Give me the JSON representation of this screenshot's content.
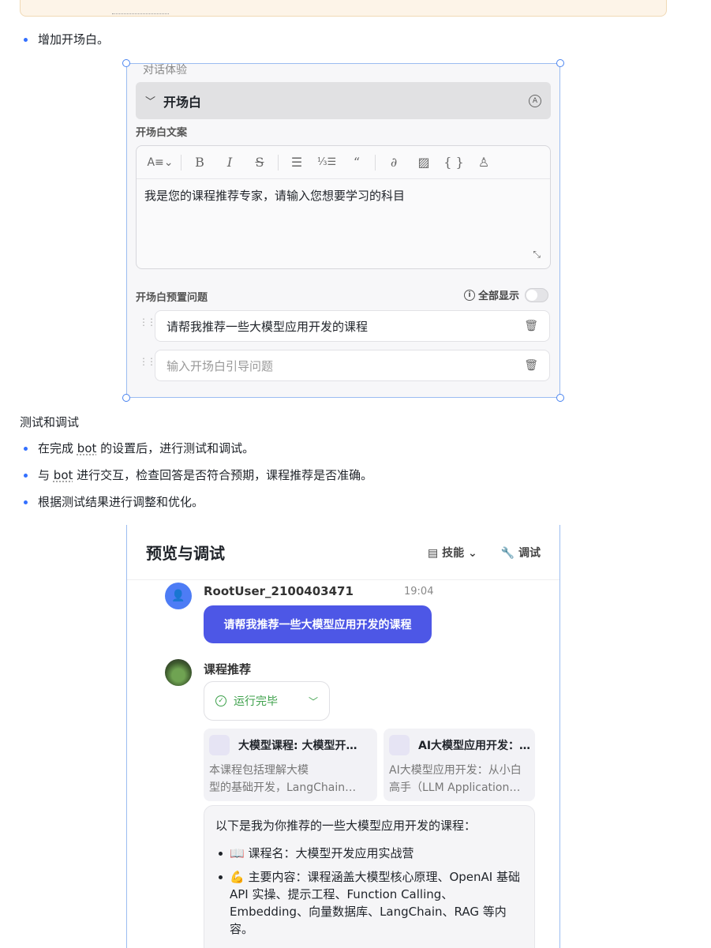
{
  "bullets_top": [
    "增加开场白。"
  ],
  "section_heading": "测试和调试",
  "bullets_test": {
    "item1_pre": "在完成",
    "item1_bot": "bot",
    "item1_post": "的设置后，进行测试和调试。",
    "item2_pre": "与",
    "item2_bot": "bot",
    "item2_post": "进行交互，检查回答是否符合预期，课程推荐是否准确。",
    "item3": "根据测试结果进行调整和优化。"
  },
  "shot1": {
    "top_label": "对话体验",
    "section_title": "开场白",
    "section_icon": "auto-icon",
    "opening_label": "开场白文案",
    "toolbar": [
      "A≡",
      "B",
      "I",
      "S",
      "list-bullet-icon",
      "list-ordered-icon",
      "quote-icon",
      "link-icon",
      "image-icon",
      "code-icon",
      "user-icon"
    ],
    "opening_text": "我是您的课程推荐专家，请输入您想要学习的科目",
    "preset_label": "开场白预置问题",
    "show_all": "全部显示",
    "question1": "请帮我推荐一些大模型应用开发的课程",
    "question_placeholder": "输入开场白引导问题"
  },
  "shot2": {
    "title": "预览与调试",
    "skills_label": "技能",
    "debug_label": "调试",
    "user_name": "RootUser_2100403471",
    "time": "19:04",
    "user_message": "请帮我推荐一些大模型应用开发的课程",
    "bot_name": "课程推荐",
    "run_status": "运行完毕",
    "card1_title": "大模型课程: 大模型开…",
    "card1_line1": "本课程包括理解大模",
    "card1_line2": "型的基础开发，LangChain…",
    "card2_title": "AI大模型应用开发：…",
    "card2_line1": "AI大模型应用开发：从小白",
    "card2_line2": "高手（LLM Application…",
    "answer_intro": "以下是我为你推荐的一些大模型应用开发的课程：",
    "answer_item1": "📖 课程名：大模型开发应用实战营",
    "answer_item2": "💪 主要内容：课程涵盖大模型核心原理、OpenAI 基础 API 实操、提示工程、Function Calling、Embedding、向量数据库、LangChain、RAG 等内容。"
  }
}
